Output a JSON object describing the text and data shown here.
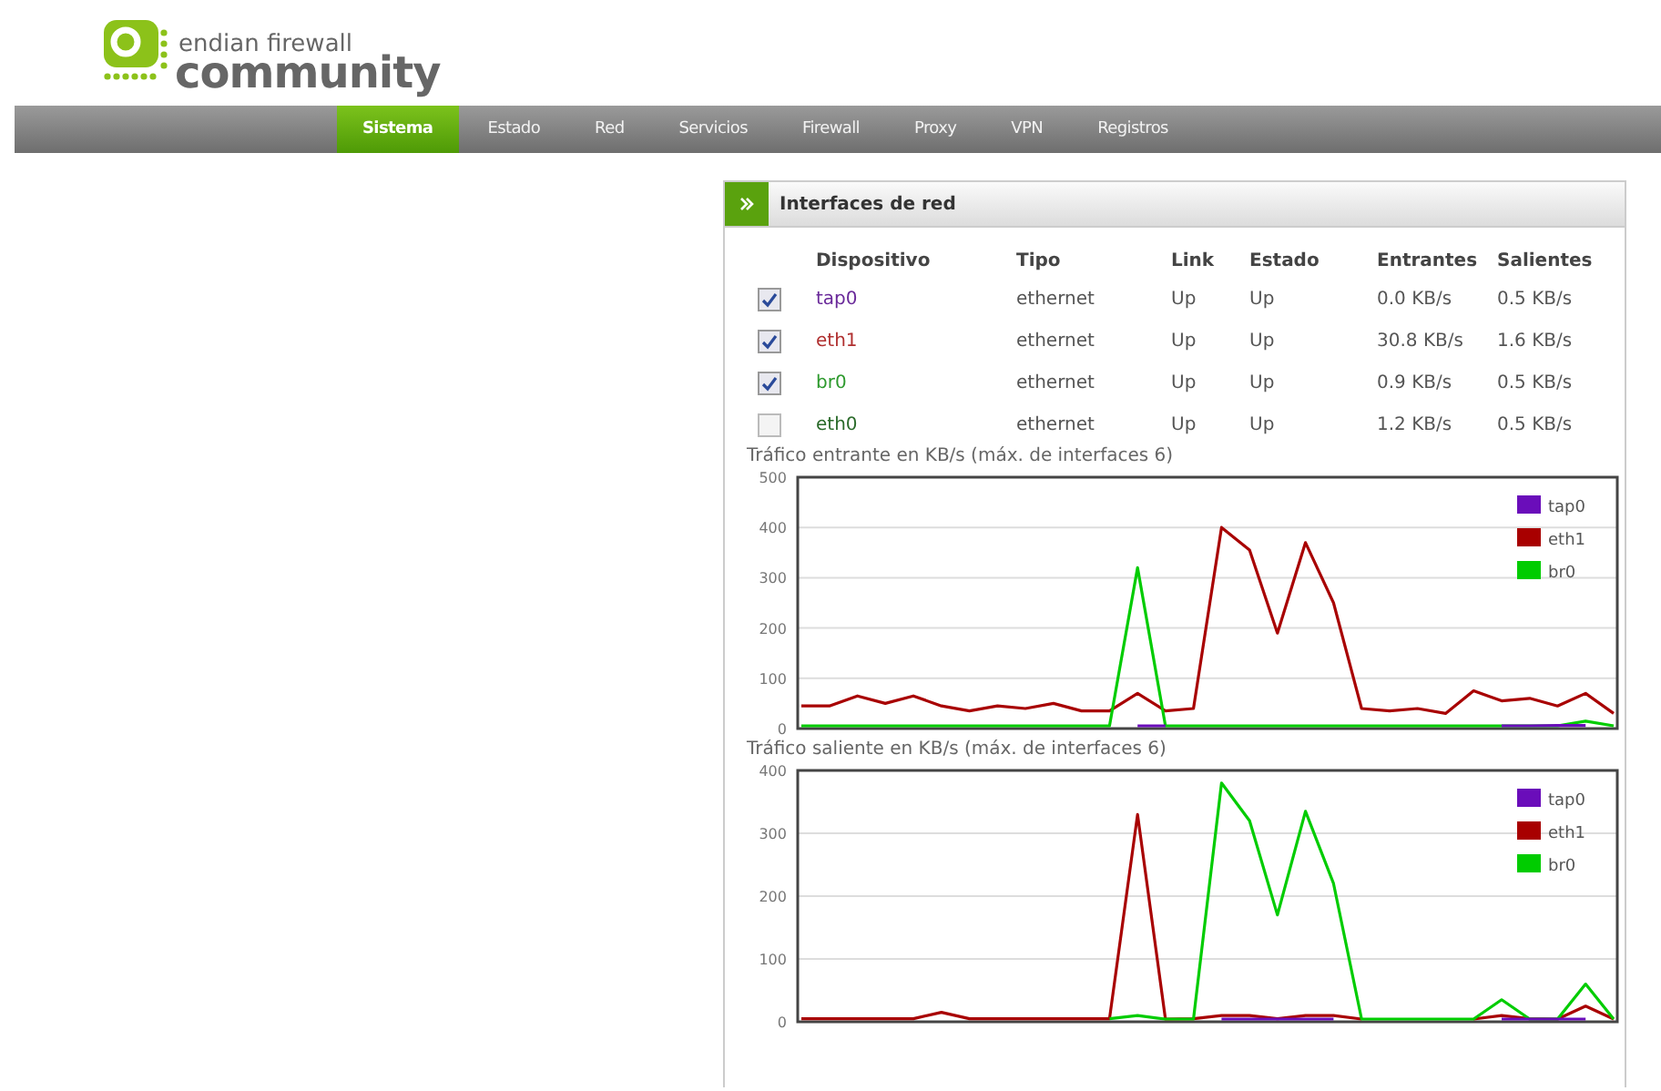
{
  "logo": {
    "line1": "endian firewall",
    "line2": "community"
  },
  "nav": [
    {
      "label": "Sistema",
      "selected": true
    },
    {
      "label": "Estado",
      "selected": false
    },
    {
      "label": "Red",
      "selected": false
    },
    {
      "label": "Servicios",
      "selected": false
    },
    {
      "label": "Firewall",
      "selected": false
    },
    {
      "label": "Proxy",
      "selected": false
    },
    {
      "label": "VPN",
      "selected": false
    },
    {
      "label": "Registros",
      "selected": false
    }
  ],
  "panel": {
    "title": "Interfaces de red",
    "columns": [
      "Dispositivo",
      "Tipo",
      "Link",
      "Estado",
      "Entrantes",
      "Salientes"
    ],
    "rows": [
      {
        "checked": true,
        "device": "tap0",
        "color": "#6a2a9a",
        "type": "ethernet",
        "link": "Up",
        "status": "Up",
        "incoming": "0.0 KB/s",
        "outgoing": "0.5 KB/s"
      },
      {
        "checked": true,
        "device": "eth1",
        "color": "#b03030",
        "type": "ethernet",
        "link": "Up",
        "status": "Up",
        "incoming": "30.8 KB/s",
        "outgoing": "1.6 KB/s"
      },
      {
        "checked": true,
        "device": "br0",
        "color": "#2e9a2e",
        "type": "ethernet",
        "link": "Up",
        "status": "Up",
        "incoming": "0.9 KB/s",
        "outgoing": "0.5 KB/s"
      },
      {
        "checked": false,
        "device": "eth0",
        "color": "#2a6a2a",
        "type": "ethernet",
        "link": "Up",
        "status": "Up",
        "incoming": "1.2 KB/s",
        "outgoing": "0.5 KB/s"
      }
    ],
    "charts": [
      {
        "chart_data": {
          "type": "line",
          "title": "Tráfico entrante en KB/s (máx. de interfaces 6)",
          "ylim": [
            0,
            500
          ],
          "yticks": [
            0,
            100,
            200,
            300,
            400,
            500
          ],
          "grid": true,
          "legend": true,
          "series": [
            {
              "name": "tap0",
              "color": "#6a0dba",
              "values": [
                null,
                null,
                null,
                null,
                null,
                null,
                null,
                null,
                null,
                null,
                null,
                null,
                4,
                4,
                null,
                null,
                null,
                null,
                null,
                null,
                null,
                null,
                null,
                null,
                null,
                4,
                4,
                6,
                6,
                null
              ]
            },
            {
              "name": "eth1",
              "color": "#a80000",
              "values": [
                45,
                45,
                65,
                50,
                65,
                45,
                35,
                45,
                40,
                50,
                35,
                35,
                70,
                35,
                40,
                400,
                355,
                190,
                370,
                250,
                40,
                35,
                40,
                30,
                75,
                55,
                60,
                45,
                70,
                30
              ]
            },
            {
              "name": "br0",
              "color": "#00cc00",
              "values": [
                0,
                0,
                0,
                0,
                0,
                0,
                0,
                0,
                0,
                0,
                0,
                0,
                320,
                0,
                0,
                5,
                5,
                0,
                5,
                0,
                0,
                0,
                0,
                0,
                0,
                0,
                5,
                0,
                15,
                0
              ]
            }
          ]
        }
      },
      {
        "chart_data": {
          "type": "line",
          "title": "Tráfico saliente en KB/s (máx. de interfaces 6)",
          "ylim": [
            0,
            400
          ],
          "yticks": [
            0,
            100,
            200,
            300,
            400
          ],
          "grid": true,
          "legend": true,
          "series": [
            {
              "name": "tap0",
              "color": "#6a0dba",
              "values": [
                null,
                null,
                null,
                null,
                null,
                null,
                null,
                null,
                null,
                null,
                null,
                null,
                null,
                null,
                null,
                3,
                3,
                3,
                3,
                3,
                null,
                null,
                null,
                null,
                null,
                3,
                3,
                3,
                3,
                null
              ]
            },
            {
              "name": "eth1",
              "color": "#a80000",
              "values": [
                5,
                5,
                5,
                5,
                5,
                15,
                5,
                5,
                5,
                5,
                5,
                5,
                330,
                0,
                5,
                10,
                10,
                5,
                10,
                10,
                0,
                null,
                null,
                null,
                0,
                10,
                5,
                0,
                25,
                0
              ]
            },
            {
              "name": "br0",
              "color": "#00cc00",
              "values": [
                null,
                null,
                null,
                null,
                null,
                null,
                null,
                null,
                null,
                null,
                null,
                5,
                10,
                0,
                0,
                380,
                320,
                170,
                335,
                220,
                0,
                0,
                0,
                0,
                0,
                35,
                0,
                0,
                60,
                0
              ]
            }
          ]
        }
      }
    ]
  }
}
